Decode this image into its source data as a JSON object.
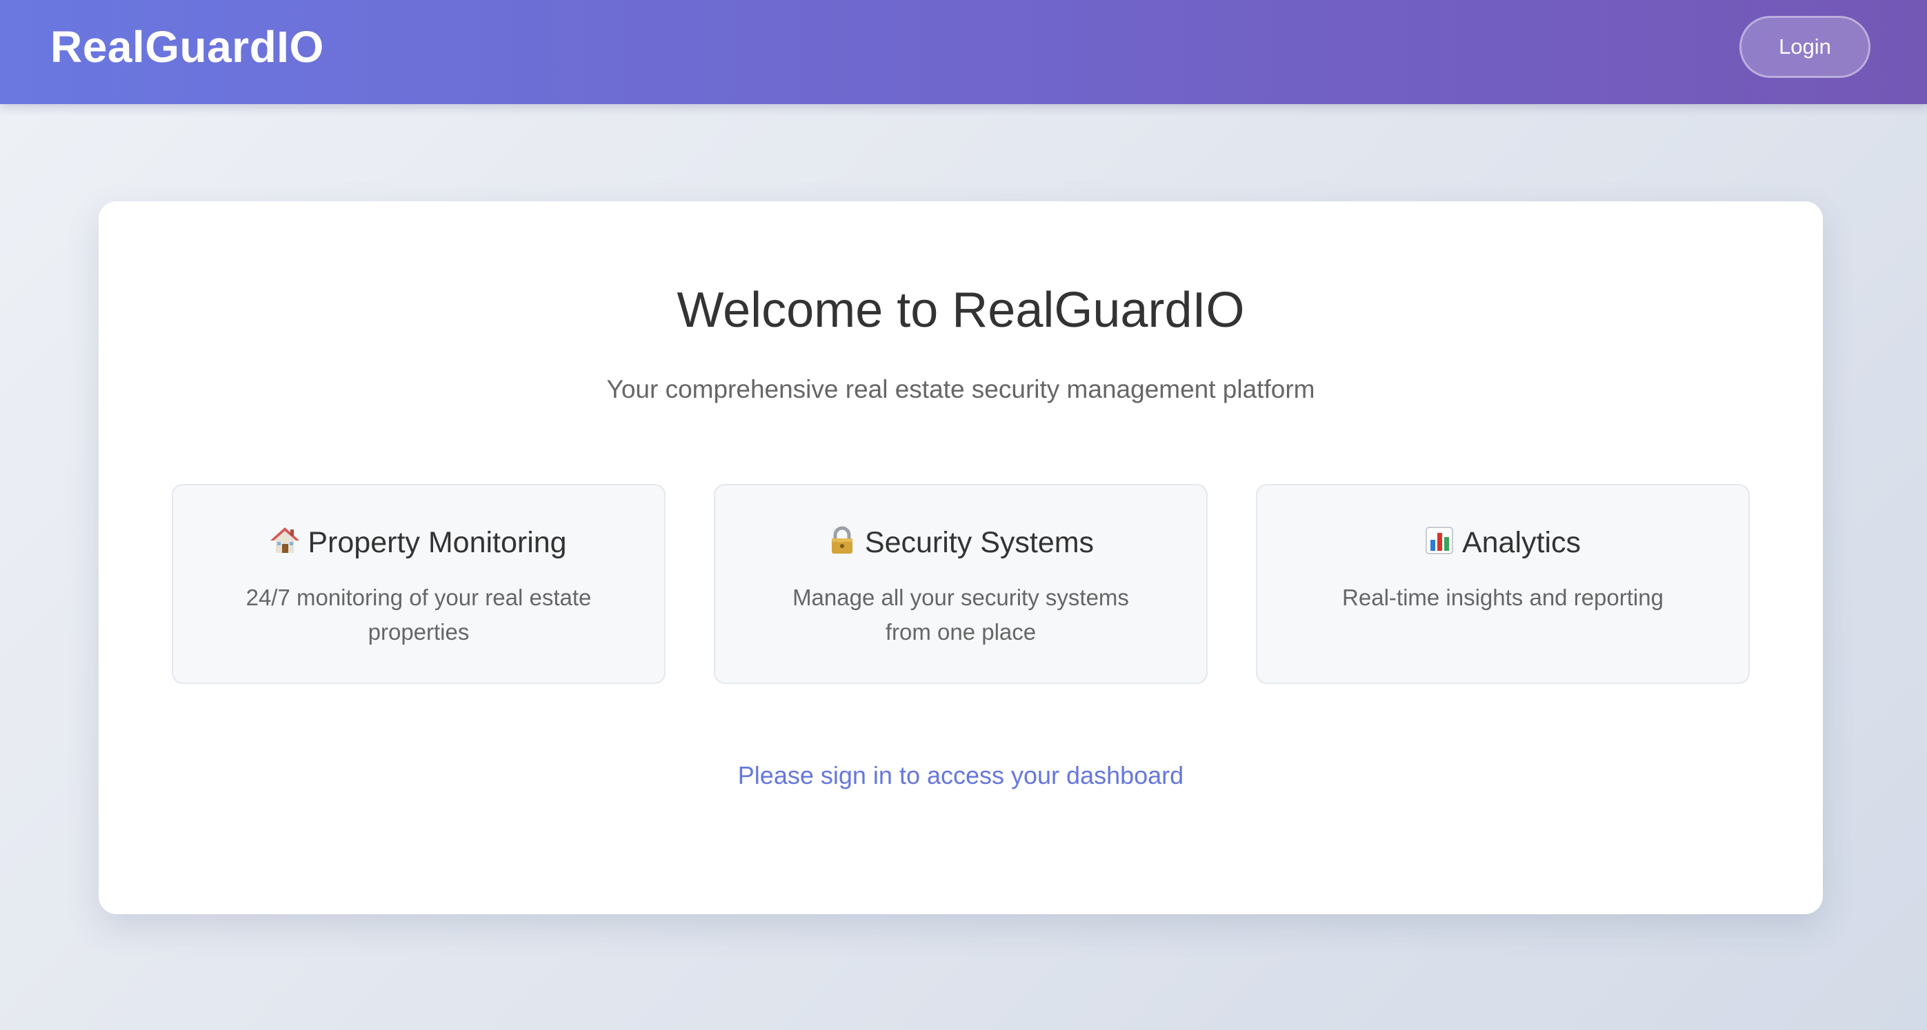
{
  "header": {
    "brand": "RealGuardIO",
    "login_label": "Login"
  },
  "hero": {
    "title": "Welcome to RealGuardIO",
    "subtitle": "Your comprehensive real estate security management platform"
  },
  "features": [
    {
      "icon": "house-icon",
      "title": "Property Monitoring",
      "description": "24/7 monitoring of your real estate properties"
    },
    {
      "icon": "lock-icon",
      "title": "Security Systems",
      "description": "Manage all your security systems from one place"
    },
    {
      "icon": "bar-chart-icon",
      "title": "Analytics",
      "description": "Real-time insights and reporting"
    }
  ],
  "signin_prompt": "Please sign in to access your dashboard",
  "colors": {
    "header_start": "#6a78e0",
    "header_end": "#7458b6",
    "link": "#6677dc",
    "title_text": "#333333",
    "muted_text": "#666666",
    "feature_bg": "#f7f8fa"
  }
}
